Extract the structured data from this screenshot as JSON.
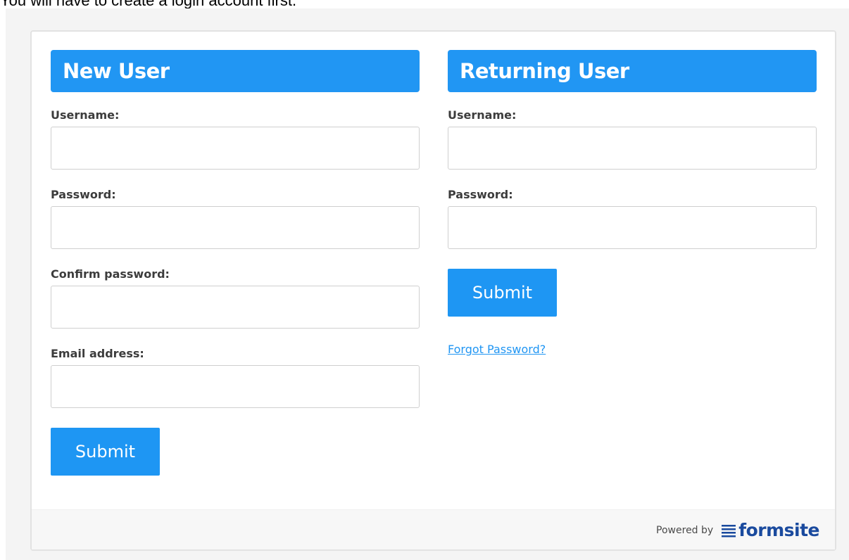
{
  "intro_text": "You will have to create a login account first.",
  "colors": {
    "header_blue": "#2196f3",
    "button_blue": "#1e96f3",
    "brand_navy": "#1a4a9e"
  },
  "new_user": {
    "title": "New User",
    "fields": [
      {
        "label": "Username:",
        "value": "",
        "placeholder": ""
      },
      {
        "label": "Password:",
        "value": "",
        "placeholder": ""
      },
      {
        "label": "Confirm password:",
        "value": "",
        "placeholder": ""
      },
      {
        "label": "Email address:",
        "value": "",
        "placeholder": ""
      }
    ],
    "submit_label": "Submit"
  },
  "returning_user": {
    "title": "Returning User",
    "fields": [
      {
        "label": "Username:",
        "value": "",
        "placeholder": ""
      },
      {
        "label": "Password:",
        "value": "",
        "placeholder": ""
      }
    ],
    "submit_label": "Submit",
    "forgot_label": "Forgot Password?"
  },
  "footer": {
    "powered_by": "Powered by",
    "brand": "formsite",
    "brand_icon": "formsite-logo-icon"
  }
}
